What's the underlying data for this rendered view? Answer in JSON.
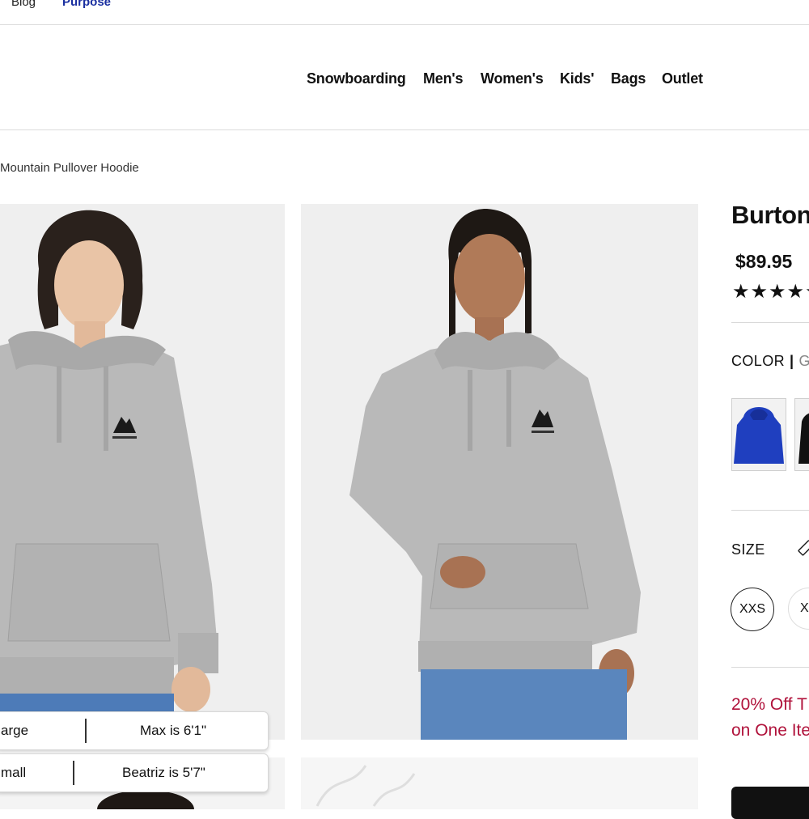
{
  "top_bar": {
    "blog": "Blog",
    "purpose": "Purpose"
  },
  "nav": [
    "Snowboarding",
    "Men's",
    "Women's",
    "Kids'",
    "Bags",
    "Outlet"
  ],
  "breadcrumb": "Mountain Pullover Hoodie",
  "model_info": [
    {
      "size_text": "arge",
      "height_text": "Max is 6'1\""
    },
    {
      "size_text": "mall",
      "height_text": "Beatriz is 5'7\""
    }
  ],
  "product": {
    "title": "Burton",
    "price": "$89.95",
    "rating_stars": "★★★★★",
    "color_label": "COLOR",
    "color_separator": "|",
    "color_value": "G",
    "size_label": "SIZE",
    "sizes": [
      "XXS",
      "X"
    ],
    "promo_line1": "20% Off T",
    "promo_line2": "on One Ite"
  },
  "colors": {
    "accent_blue": "#1a2fa0",
    "promo_red": "#b0123b",
    "hoodie_gray": "#b9b9b9",
    "swatch_blue": "#1f3fbf"
  },
  "icons": [
    "ruler-icon",
    "star-icon"
  ]
}
